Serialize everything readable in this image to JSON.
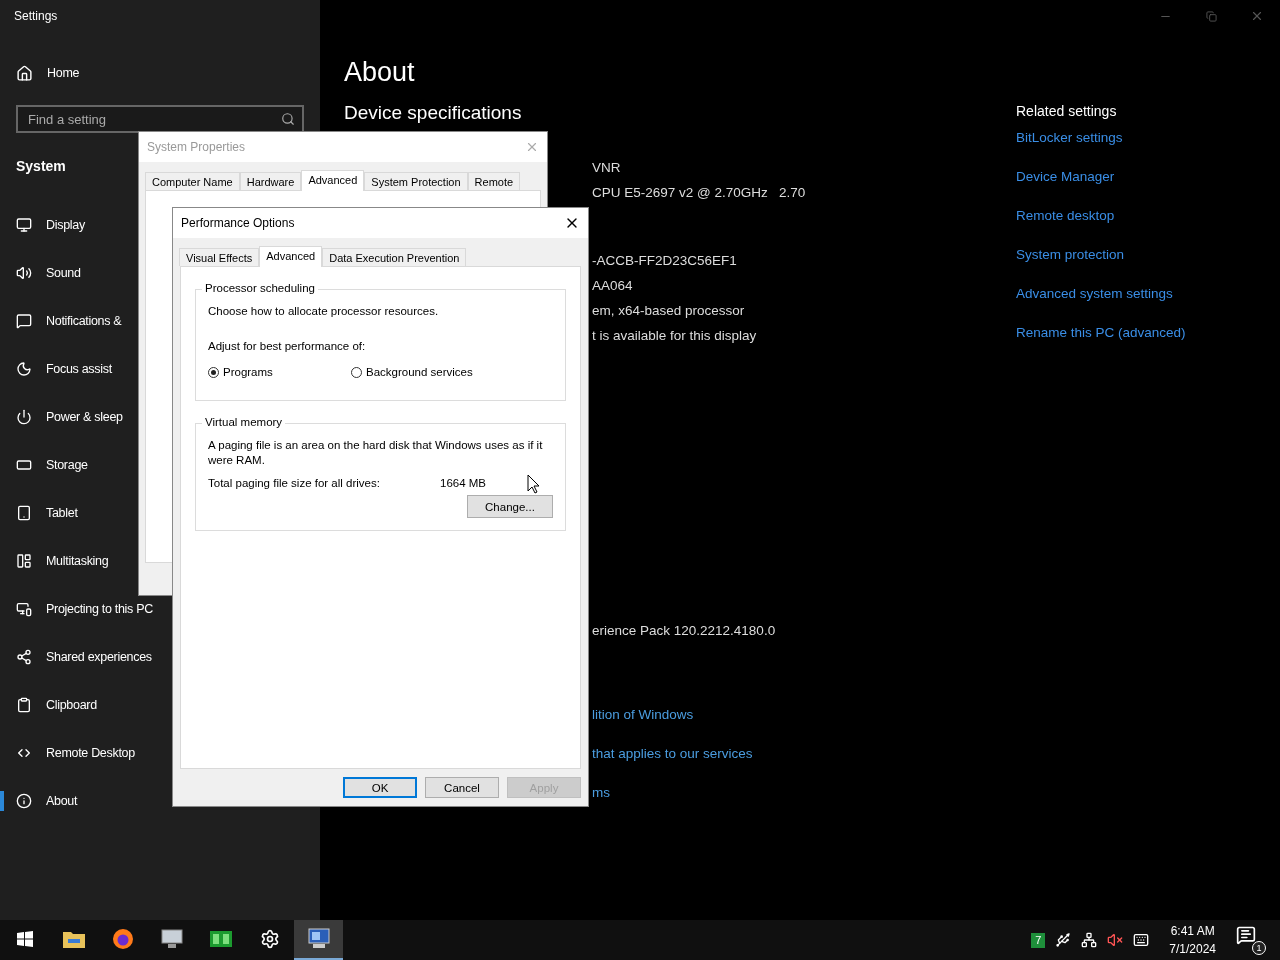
{
  "settings": {
    "title": "Settings",
    "home": "Home",
    "search": {
      "placeholder": "Find a setting"
    },
    "section": "System",
    "nav": [
      {
        "label": "Display",
        "selected": false
      },
      {
        "label": "Sound",
        "selected": false
      },
      {
        "label": "Notifications &",
        "selected": false
      },
      {
        "label": "Focus assist",
        "selected": false
      },
      {
        "label": "Power & sleep",
        "selected": false
      },
      {
        "label": "Storage",
        "selected": false
      },
      {
        "label": "Tablet",
        "selected": false
      },
      {
        "label": "Multitasking",
        "selected": false
      },
      {
        "label": "Projecting to this PC",
        "selected": false
      },
      {
        "label": "Shared experiences",
        "selected": false
      },
      {
        "label": "Clipboard",
        "selected": false
      },
      {
        "label": "Remote Desktop",
        "selected": false
      },
      {
        "label": "About",
        "selected": true
      }
    ],
    "page_title": "About",
    "heading": "Device specifications",
    "device_lines": [
      "VNR",
      "CPU E5-2697 v2 @ 2.70GHz   2.70",
      "-ACCB-FF2D23C56EF1",
      "AA064",
      "em, x64-based processor",
      "t is available for this display"
    ],
    "windows_lines": [
      "erience Pack 120.2212.4180.0"
    ],
    "links": [
      "lition of Windows",
      "that applies to our services",
      "ms"
    ],
    "related": {
      "title": "Related settings",
      "links": [
        "BitLocker settings",
        "Device Manager",
        "Remote desktop",
        "System protection",
        "Advanced system settings",
        "Rename this PC (advanced)"
      ]
    }
  },
  "system_properties": {
    "title": "System Properties",
    "tabs": [
      {
        "label": "Computer Name",
        "selected": false
      },
      {
        "label": "Hardware",
        "selected": false
      },
      {
        "label": "Advanced",
        "selected": true
      },
      {
        "label": "System Protection",
        "selected": false
      },
      {
        "label": "Remote",
        "selected": false
      }
    ]
  },
  "performance_options": {
    "title": "Performance Options",
    "tabs": [
      {
        "label": "Visual Effects",
        "selected": false
      },
      {
        "label": "Advanced",
        "selected": true
      },
      {
        "label": "Data Execution Prevention",
        "selected": false
      }
    ],
    "processor_scheduling": {
      "legend": "Processor scheduling",
      "description": "Choose how to allocate processor resources.",
      "prompt": "Adjust for best performance of:",
      "options": [
        {
          "label": "Programs",
          "selected": true
        },
        {
          "label": "Background services",
          "selected": false
        }
      ]
    },
    "virtual_memory": {
      "legend": "Virtual memory",
      "description": "A paging file is an area on the hard disk that Windows uses as if it were RAM.",
      "total_label": "Total paging file size for all drives:",
      "total_value": "1664 MB",
      "change_button": "Change..."
    },
    "buttons": [
      {
        "label": "OK",
        "default": true,
        "disabled": false
      },
      {
        "label": "Cancel",
        "default": false,
        "disabled": false
      },
      {
        "label": "Apply",
        "default": false,
        "disabled": true
      }
    ]
  },
  "taskbar": {
    "apps": [
      {
        "selected": false
      },
      {
        "selected": false
      },
      {
        "selected": false
      },
      {
        "selected": false
      },
      {
        "selected": false
      },
      {
        "selected": true
      }
    ],
    "tray_badge": "7",
    "time": "6:41 AM",
    "date": "7/1/2024",
    "notification_count": "1"
  }
}
